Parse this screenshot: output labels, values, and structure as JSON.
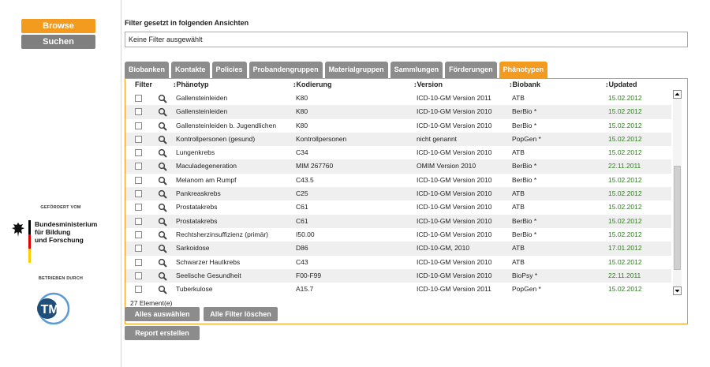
{
  "sidebar": {
    "browse_label": "Browse",
    "suchen_label": "Suchen",
    "sponsor_label": "GEFÖRDERT VOM",
    "bmbf_lines": [
      "Bundesministerium",
      "für Bildung",
      "und Forschung"
    ],
    "operator_label": "BETRIEBEN DURCH",
    "tmf_logo_text": "TMF"
  },
  "filter": {
    "title": "Filter gesetzt in folgenden Ansichten",
    "value": "Keine Filter ausgewählt"
  },
  "tabs": [
    {
      "label": "Biobanken",
      "active": false
    },
    {
      "label": "Kontakte",
      "active": false
    },
    {
      "label": "Policies",
      "active": false
    },
    {
      "label": "Probandengruppen",
      "active": false
    },
    {
      "label": "Materialgruppen",
      "active": false
    },
    {
      "label": "Sammlungen",
      "active": false
    },
    {
      "label": "Förderungen",
      "active": false
    },
    {
      "label": "Phänotypen",
      "active": true
    }
  ],
  "table": {
    "headers": {
      "filter": "Filter",
      "phaenotyp": "Phänotyp",
      "kodierung": "Kodierung",
      "version": "Version",
      "biobank": "Biobank",
      "updated": "Updated"
    },
    "rows": [
      {
        "phaenotyp": "Gallensteinleiden",
        "kodierung": "K80",
        "version": "ICD-10-GM Version 2011",
        "biobank": "ATB",
        "updated": "15.02.2012"
      },
      {
        "phaenotyp": "Gallensteinleiden",
        "kodierung": "K80",
        "version": "ICD-10-GM Version 2010",
        "biobank": "BerBio *",
        "updated": "15.02.2012"
      },
      {
        "phaenotyp": "Gallensteinleiden b. Jugendlichen",
        "kodierung": "K80",
        "version": "ICD-10-GM Version 2010",
        "biobank": "BerBio *",
        "updated": "15.02.2012"
      },
      {
        "phaenotyp": "Kontrollpersonen (gesund)",
        "kodierung": "Kontrollpersonen",
        "version": "nicht genannt",
        "biobank": "PopGen *",
        "updated": "15.02.2012"
      },
      {
        "phaenotyp": "Lungenkrebs",
        "kodierung": "C34",
        "version": "ICD-10-GM Version 2010",
        "biobank": "ATB",
        "updated": "15.02.2012"
      },
      {
        "phaenotyp": "Maculadegeneration",
        "kodierung": "MIM 267760",
        "version": "OMIM Version 2010",
        "biobank": "BerBio *",
        "updated": "22.11.2011"
      },
      {
        "phaenotyp": "Melanom am Rumpf",
        "kodierung": "C43.5",
        "version": "ICD-10-GM Version 2010",
        "biobank": "BerBio *",
        "updated": "15.02.2012"
      },
      {
        "phaenotyp": "Pankreaskrebs",
        "kodierung": "C25",
        "version": "ICD-10-GM Version 2010",
        "biobank": "ATB",
        "updated": "15.02.2012"
      },
      {
        "phaenotyp": "Prostatakrebs",
        "kodierung": "C61",
        "version": "ICD-10-GM Version 2010",
        "biobank": "ATB",
        "updated": "15.02.2012"
      },
      {
        "phaenotyp": "Prostatakrebs",
        "kodierung": "C61",
        "version": "ICD-10-GM Version 2010",
        "biobank": "BerBio *",
        "updated": "15.02.2012"
      },
      {
        "phaenotyp": "Rechtsherzinsuffizienz (primär)",
        "kodierung": "I50.00",
        "version": "ICD-10-GM Version 2010",
        "biobank": "BerBio *",
        "updated": "15.02.2012"
      },
      {
        "phaenotyp": "Sarkoidose",
        "kodierung": "D86",
        "version": "ICD-10-GM, 2010",
        "biobank": "ATB",
        "updated": "17.01.2012"
      },
      {
        "phaenotyp": "Schwarzer Hautkrebs",
        "kodierung": "C43",
        "version": "ICD-10-GM Version 2010",
        "biobank": "ATB",
        "updated": "15.02.2012"
      },
      {
        "phaenotyp": "Seelische Gesundheit",
        "kodierung": "F00-F99",
        "version": "ICD-10-GM Version 2010",
        "biobank": "BioPsy *",
        "updated": "22.11.2011"
      },
      {
        "phaenotyp": "Tuberkulose",
        "kodierung": "A15.7",
        "version": "ICD-10-GM Version 2011",
        "biobank": "PopGen *",
        "updated": "15.02.2012"
      }
    ],
    "count_text": "27 Element(e)"
  },
  "actions": {
    "select_all": "Alles auswählen",
    "clear_filters": "Alle Filter löschen",
    "create_report": "Report erstellen"
  },
  "colors": {
    "accent": "#f39b1f",
    "button_gray": "#8c8c8c",
    "date_green": "#2e7d1e"
  }
}
